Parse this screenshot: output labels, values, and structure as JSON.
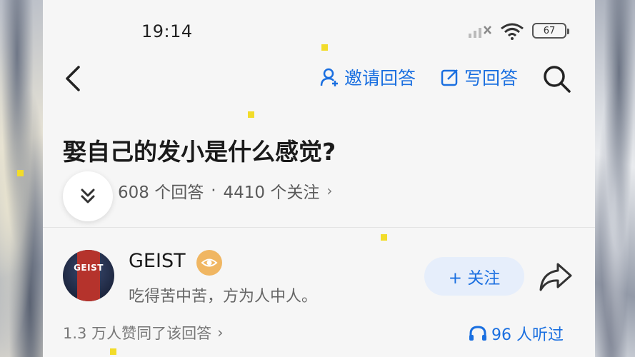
{
  "status_bar": {
    "time": "19:14",
    "battery": "67"
  },
  "nav": {
    "invite_label": "邀请回答",
    "write_label": "写回答"
  },
  "question": {
    "title": "娶自己的发小是什么感觉?",
    "answers_count": "608 个回答",
    "separator": "·",
    "followers_count": "4410 个关注",
    "chevron": "›"
  },
  "answer": {
    "author_name": "GEIST",
    "avatar_text": "GEIST",
    "author_bio": "吃得苦中苦，方为人中人。",
    "follow_label": "+ 关注",
    "likes_text": "1.3 万人赞同了该回答",
    "likes_chevron": "›",
    "listened_text": "96 人听过"
  },
  "colors": {
    "accent": "#1a6fe0",
    "badge": "#f0b662",
    "follow_bg": "#e6eefb"
  },
  "icons": {
    "back": "back-arrow-icon",
    "invite": "person-add-icon",
    "write": "edit-icon",
    "search": "search-icon",
    "collapse": "double-chevron-down-icon",
    "share": "share-arrow-icon",
    "headphones": "headphones-icon",
    "badge": "eye-badge-icon"
  }
}
